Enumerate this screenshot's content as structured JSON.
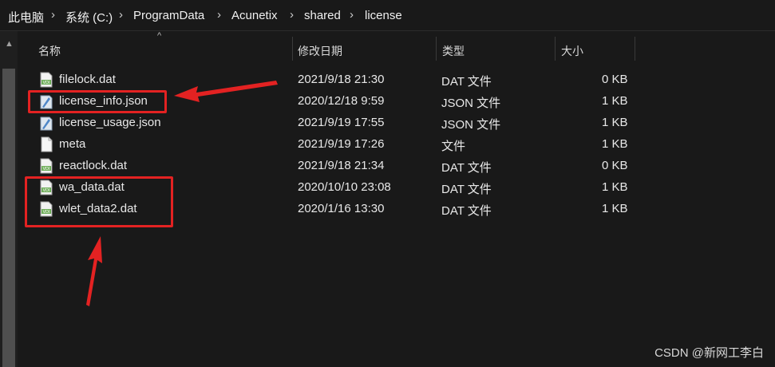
{
  "breadcrumb": {
    "items": [
      "此电脑",
      "系统 (C:)",
      "ProgramData",
      "Acunetix",
      "shared",
      "license"
    ],
    "separator": "›"
  },
  "columns": {
    "name": "名称",
    "modified": "修改日期",
    "type": "类型",
    "size": "大小"
  },
  "files": [
    {
      "name": "filelock.dat",
      "modified": "2021/9/18 21:30",
      "type": "DAT 文件",
      "size": "0 KB",
      "icon": "dat-file-icon"
    },
    {
      "name": "license_info.json",
      "modified": "2020/12/18 9:59",
      "type": "JSON 文件",
      "size": "1 KB",
      "icon": "json-file-icon"
    },
    {
      "name": "license_usage.json",
      "modified": "2021/9/19 17:55",
      "type": "JSON 文件",
      "size": "1 KB",
      "icon": "json-file-icon"
    },
    {
      "name": "meta",
      "modified": "2021/9/19 17:26",
      "type": "文件",
      "size": "1 KB",
      "icon": "blank-file-icon"
    },
    {
      "name": "reactlock.dat",
      "modified": "2021/9/18 21:34",
      "type": "DAT 文件",
      "size": "0 KB",
      "icon": "dat-file-icon"
    },
    {
      "name": "wa_data.dat",
      "modified": "2020/10/10 23:08",
      "type": "DAT 文件",
      "size": "1 KB",
      "icon": "dat-file-icon"
    },
    {
      "name": "wlet_data2.dat",
      "modified": "2020/1/16 13:30",
      "type": "DAT 文件",
      "size": "1 KB",
      "icon": "dat-file-icon"
    }
  ],
  "annotations": {
    "color": "#e32222"
  },
  "watermark": "CSDN @新网工李白"
}
